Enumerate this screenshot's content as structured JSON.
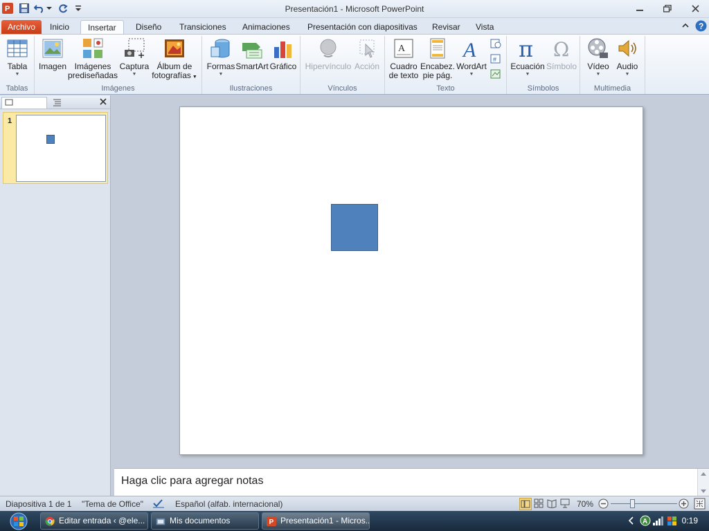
{
  "window": {
    "title": "Presentación1  -  Microsoft PowerPoint"
  },
  "tabs": [
    {
      "label": "Archivo"
    },
    {
      "label": "Inicio"
    },
    {
      "label": "Insertar"
    },
    {
      "label": "Diseño"
    },
    {
      "label": "Transiciones"
    },
    {
      "label": "Animaciones"
    },
    {
      "label": "Presentación con diapositivas"
    },
    {
      "label": "Revisar"
    },
    {
      "label": "Vista"
    }
  ],
  "active_tab": "Insertar",
  "ribbon": {
    "groups": {
      "tablas": "Tablas",
      "imagenes": "Imágenes",
      "ilustraciones": "Ilustraciones",
      "vinculos": "Vínculos",
      "texto": "Texto",
      "simbolos": "Símbolos",
      "multimedia": "Multimedia"
    },
    "buttons": {
      "tabla": "Tabla",
      "imagen": "Imagen",
      "imagenes_l1": "Imágenes",
      "imagenes_l2": "prediseñadas",
      "captura": "Captura",
      "album_l1": "Álbum de",
      "album_l2": "fotografías",
      "formas": "Formas",
      "smartart": "SmartArt",
      "grafico": "Gráfico",
      "hipervinculo": "Hipervínculo",
      "accion": "Acción",
      "cuadro_l1": "Cuadro",
      "cuadro_l2": "de texto",
      "encabez_l1": "Encabez.",
      "encabez_l2": "pie pág.",
      "wordart": "WordArt",
      "ecuacion": "Ecuación",
      "simbolo": "Símbolo",
      "video": "Vídeo",
      "audio": "Audio"
    }
  },
  "slides_pane": {
    "thumb_number": "1"
  },
  "notes": {
    "placeholder": "Haga clic para agregar notas"
  },
  "status": {
    "slide_info": "Diapositiva 1 de 1",
    "theme": "\"Tema de Office\"",
    "language": "Español (alfab. internacional)",
    "zoom": "70%"
  },
  "taskbar": {
    "items": [
      {
        "label": "Editar entrada ‹ @ele..."
      },
      {
        "label": "Mis documentos"
      },
      {
        "label": "Presentación1 - Micros..."
      }
    ],
    "clock": "0:19"
  },
  "colors": {
    "shape_fill": "#4f81bd",
    "shape_border": "#385d8a",
    "file_tab": "#d24726"
  }
}
